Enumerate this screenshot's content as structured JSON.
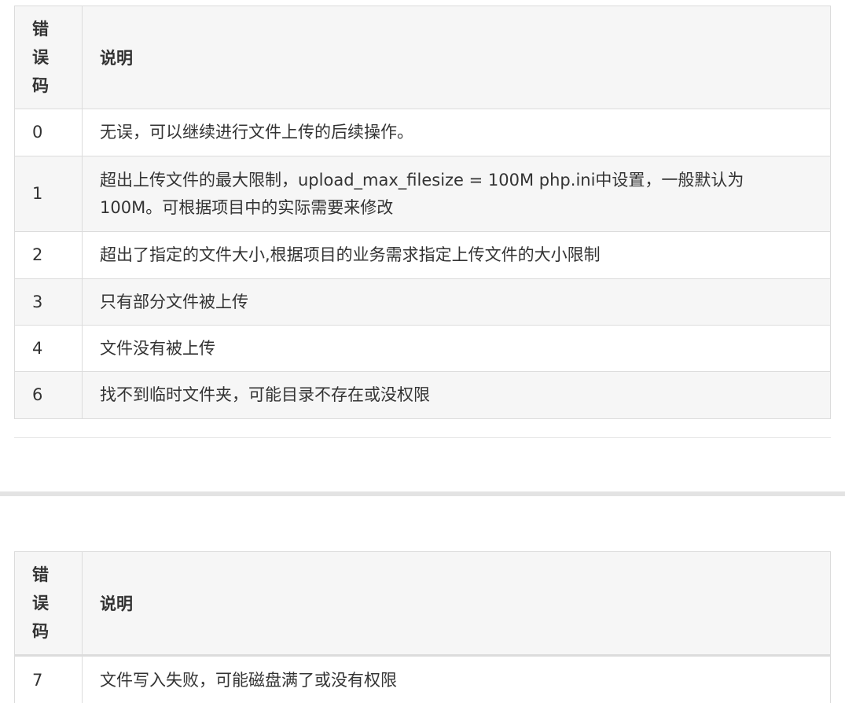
{
  "tables": [
    {
      "headers": {
        "code": [
          "错",
          "误",
          "码"
        ],
        "description": "说明"
      },
      "rows": [
        {
          "code": "0",
          "description": "无误，可以继续进行文件上传的后续操作。"
        },
        {
          "code": "1",
          "description_line1": "超出上传文件的最大限制，upload_max_filesize = 100M php.ini中设置，一般默认为",
          "description_line2": "100M。可根据项目中的实际需要来修改"
        },
        {
          "code": "2",
          "description": "超出了指定的文件大小,根据项目的业务需求指定上传文件的大小限制"
        },
        {
          "code": "3",
          "description": "只有部分文件被上传"
        },
        {
          "code": "4",
          "description": "文件没有被上传"
        },
        {
          "code": "6",
          "description": "找不到临时文件夹，可能目录不存在或没权限"
        }
      ]
    },
    {
      "headers": {
        "code": [
          "错",
          "误",
          "码"
        ],
        "description": "说明"
      },
      "rows": [
        {
          "code": "7",
          "description": "文件写入失败，可能磁盘满了或没有权限"
        }
      ]
    }
  ]
}
